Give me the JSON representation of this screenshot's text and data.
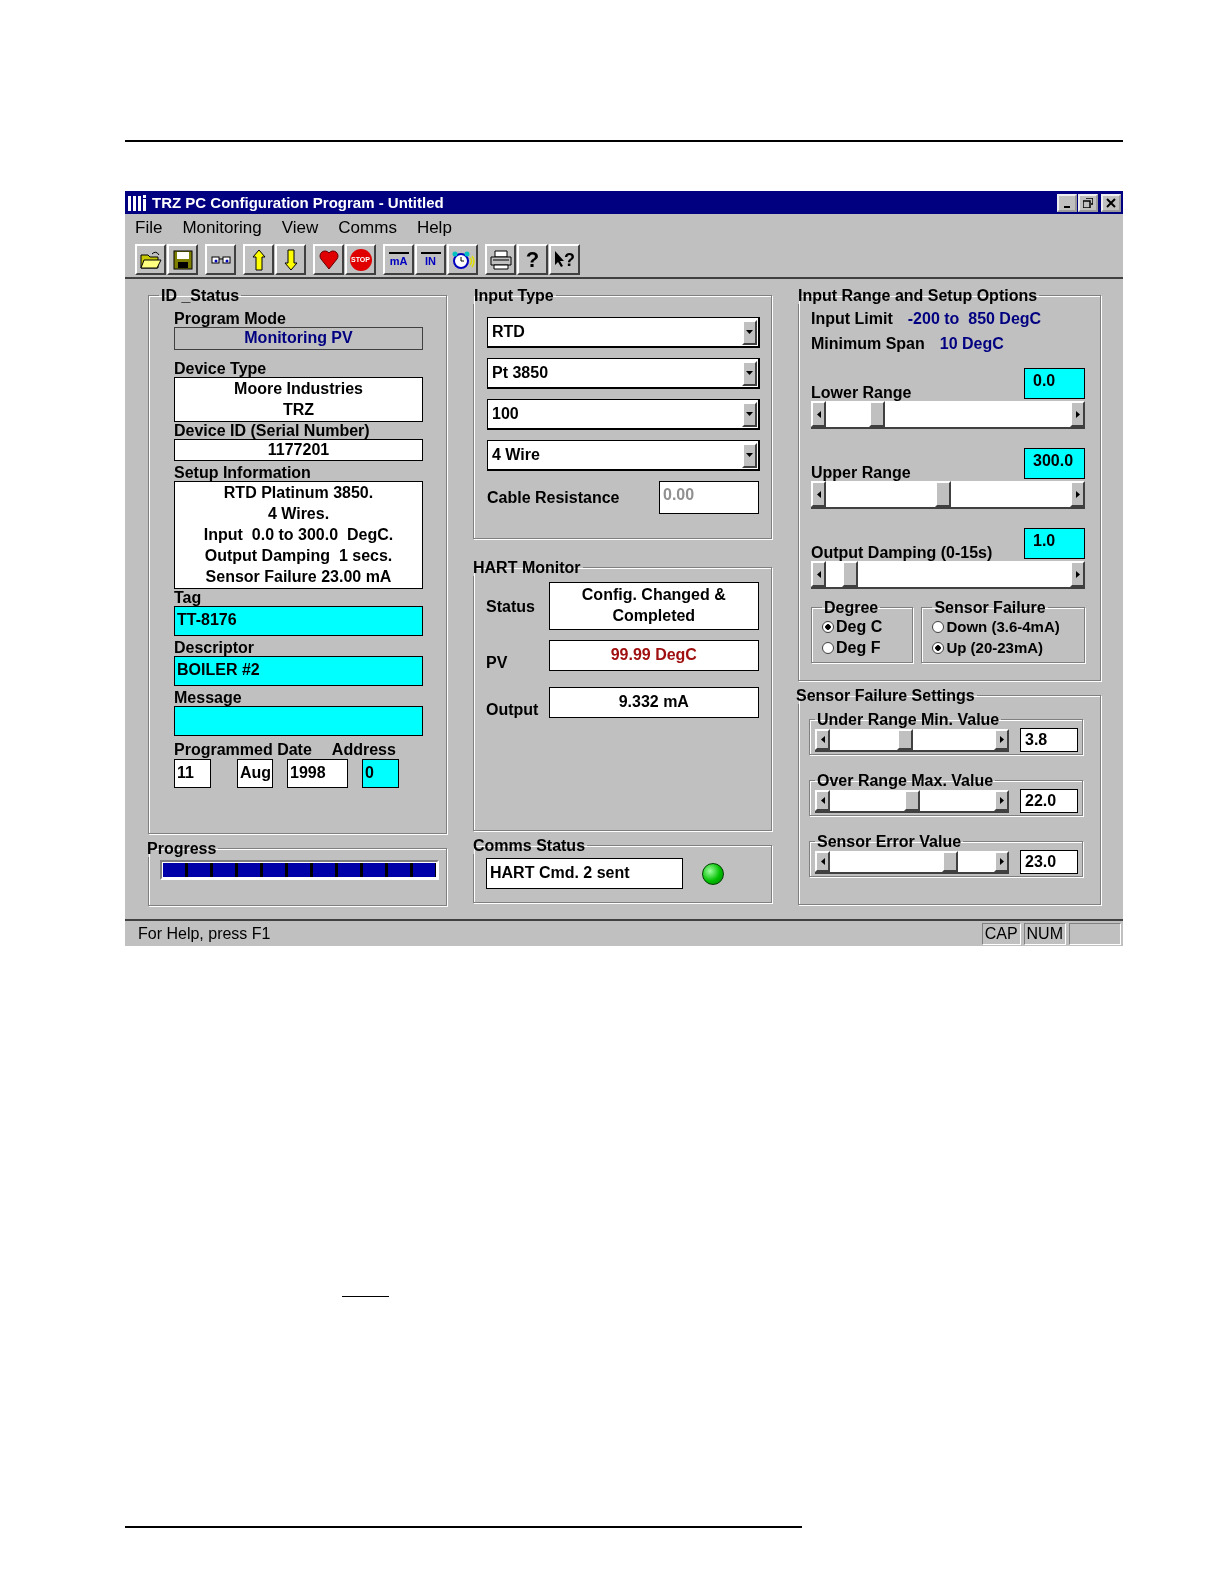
{
  "window": {
    "title": "TRZ PC Configuration Program - Untitled"
  },
  "menu": [
    {
      "label": "File"
    },
    {
      "label": "Monitoring"
    },
    {
      "label": "View"
    },
    {
      "label": "Comms"
    },
    {
      "label": "Help"
    }
  ],
  "toolbar": [
    [
      {
        "kind": "open"
      },
      {
        "kind": "save"
      }
    ],
    [
      {
        "kind": "glasses"
      }
    ],
    [
      {
        "kind": "up"
      },
      {
        "kind": "down"
      }
    ],
    [
      {
        "kind": "heart"
      },
      {
        "kind": "stop",
        "text": "STOP"
      }
    ],
    [
      {
        "kind": "ma",
        "text": "mA"
      },
      {
        "kind": "in",
        "text": "IN"
      },
      {
        "kind": "alarm"
      }
    ],
    [
      {
        "kind": "print"
      },
      {
        "kind": "help",
        "text": "?"
      },
      {
        "kind": "pointer_help",
        "text": "?"
      }
    ]
  ],
  "id_status": {
    "title": "ID _Status",
    "program_mode": {
      "label": "Program Mode",
      "value": "Monitoring PV"
    },
    "device_type": {
      "label": "Device Type",
      "lines": [
        "Moore Industries",
        "TRZ"
      ]
    },
    "device_id": {
      "label": "Device ID (Serial Number)",
      "value": "1177201"
    },
    "setup_information": {
      "label": "Setup Information",
      "lines": [
        "RTD Platinum 3850.",
        "4 Wires.",
        "Input  0.0 to 300.0  DegC.",
        "Output Damping  1 secs.",
        "Sensor Failure 23.00 mA"
      ]
    },
    "tag": {
      "label": "Tag",
      "value": "TT-8176"
    },
    "descriptor": {
      "label": "Descriptor",
      "value": "BOILER #2"
    },
    "message": {
      "label": "Message"
    },
    "programmed_date": {
      "label": "Programmed Date",
      "day": "11",
      "month": "Aug",
      "year": "1998"
    },
    "address": {
      "label": "Address",
      "value": "0"
    }
  },
  "progress": {
    "title": "Progress",
    "level": 1
  },
  "input_type": {
    "title": "Input Type",
    "selects": [
      "RTD",
      "Pt 3850",
      "100",
      "4 Wire"
    ],
    "cable_resistance": {
      "label": "Cable Resistance",
      "value": "0.00",
      "disabled": true
    }
  },
  "hart_monitor": {
    "title": "HART Monitor",
    "status": {
      "label": "Status",
      "lines": [
        "Config. Changed &",
        "Completed"
      ]
    },
    "pv": {
      "label": "PV",
      "value": "99.99 DegC"
    },
    "output": {
      "label": "Output",
      "value": "9.332 mA"
    }
  },
  "comms_status": {
    "title": "Comms Status",
    "value": "HART Cmd. 2 sent",
    "on": true
  },
  "input_range": {
    "title": "Input Range and Setup Options",
    "input_limit": {
      "label": "Input Limit",
      "value": "-200 to  850 DegC"
    },
    "minimum_span": {
      "label": "Minimum Span",
      "value": "10 DegC"
    },
    "sliders": [
      {
        "label": "Lower Range",
        "value": "0.0",
        "level": 0.19
      },
      {
        "label": "Upper Range",
        "value": "300.0",
        "level": 0.48
      },
      {
        "label": "Output Damping (0-15s)",
        "value": "1.0",
        "level": 0.07
      }
    ],
    "degree": {
      "title": "Degree",
      "options": [
        {
          "label": "Deg C",
          "selected": true
        },
        {
          "label": "Deg F",
          "selected": false
        }
      ]
    },
    "sensor_failure": {
      "title": "Sensor Failure",
      "options": [
        {
          "label": "Down (3.6-4mA)",
          "selected": false
        },
        {
          "label": "Up (20-23mA)",
          "selected": true
        }
      ]
    }
  },
  "sensor_failure_settings": {
    "title": "Sensor Failure Settings",
    "groups": [
      {
        "title": "Under Range Min. Value",
        "value": "3.8",
        "level": 0.45
      },
      {
        "title": "Over Range Max. Value",
        "value": "22.0",
        "level": 0.5
      },
      {
        "title": "Sensor Error Value",
        "value": "23.0",
        "level": 0.76
      }
    ]
  },
  "status_bar": {
    "text": "For Help, press F1",
    "indicators": [
      "CAP",
      "NUM"
    ]
  }
}
